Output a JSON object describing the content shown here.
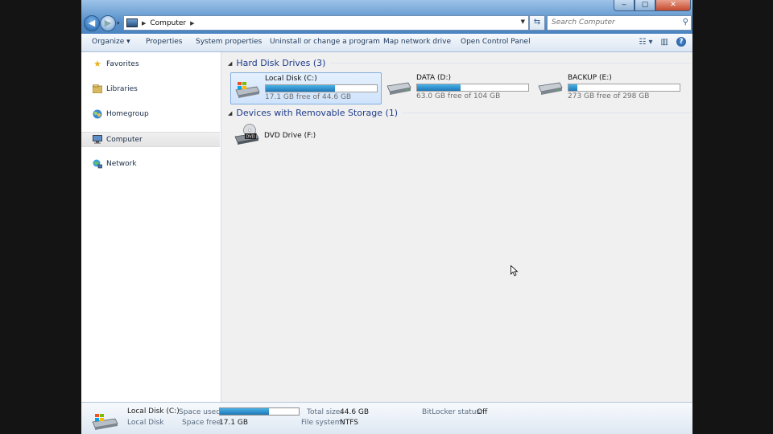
{
  "window": {
    "address": {
      "crumb": "Computer"
    },
    "search": {
      "placeholder": "Search Computer"
    },
    "caption": {
      "min": "‒",
      "max": "▢",
      "close": "✕"
    }
  },
  "toolbar": {
    "organize": "Organize ▾",
    "properties": "Properties",
    "system_properties": "System properties",
    "uninstall": "Uninstall or change a program",
    "map_drive": "Map network drive",
    "control_panel": "Open Control Panel"
  },
  "navpane": {
    "items": [
      {
        "label": "Favorites",
        "icon": "star-icon"
      },
      {
        "label": "Libraries",
        "icon": "libraries-icon"
      },
      {
        "label": "Homegroup",
        "icon": "homegroup-icon"
      },
      {
        "label": "Computer",
        "icon": "computer-icon",
        "selected": true
      },
      {
        "label": "Network",
        "icon": "network-icon"
      }
    ]
  },
  "groups": {
    "hard_disks": "Hard Disk Drives (3)",
    "removable": "Devices with Removable Storage (1)"
  },
  "drives": [
    {
      "name": "Local Disk (C:)",
      "free": "17.1 GB free of 44.6 GB",
      "used_fraction": 0.62,
      "selected": true
    },
    {
      "name": "DATA (D:)",
      "free": "63.0 GB free of 104 GB",
      "used_fraction": 0.39
    },
    {
      "name": "BACKUP (E:)",
      "free": "273 GB free of 298 GB",
      "used_fraction": 0.08
    }
  ],
  "dvd": {
    "name": "DVD Drive (F:)",
    "icon_label": "DVD"
  },
  "status": {
    "name": "Local Disk (C:)",
    "type": "Local Disk",
    "space_used_label": "Space used:",
    "space_free_label": "Space free:",
    "space_free": "17.1 GB",
    "total_size_label": "Total size:",
    "total_size": "44.6 GB",
    "file_system_label": "File system:",
    "file_system": "NTFS",
    "bitlocker_label": "BitLocker status:",
    "bitlocker": "Off",
    "used_fraction": 0.62
  },
  "colors": {
    "selection": "#cfe3fb",
    "group_title": "#1e3c8c",
    "bar_fill": "#1f76b8"
  }
}
